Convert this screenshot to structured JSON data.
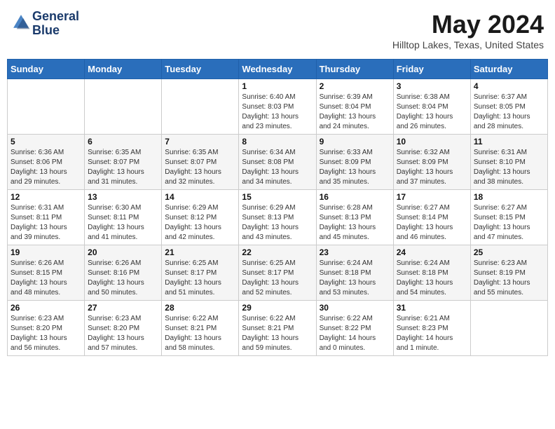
{
  "header": {
    "logo_line1": "General",
    "logo_line2": "Blue",
    "month_title": "May 2024",
    "location": "Hilltop Lakes, Texas, United States"
  },
  "weekdays": [
    "Sunday",
    "Monday",
    "Tuesday",
    "Wednesday",
    "Thursday",
    "Friday",
    "Saturday"
  ],
  "weeks": [
    [
      {
        "day": "",
        "info": ""
      },
      {
        "day": "",
        "info": ""
      },
      {
        "day": "",
        "info": ""
      },
      {
        "day": "1",
        "info": "Sunrise: 6:40 AM\nSunset: 8:03 PM\nDaylight: 13 hours\nand 23 minutes."
      },
      {
        "day": "2",
        "info": "Sunrise: 6:39 AM\nSunset: 8:04 PM\nDaylight: 13 hours\nand 24 minutes."
      },
      {
        "day": "3",
        "info": "Sunrise: 6:38 AM\nSunset: 8:04 PM\nDaylight: 13 hours\nand 26 minutes."
      },
      {
        "day": "4",
        "info": "Sunrise: 6:37 AM\nSunset: 8:05 PM\nDaylight: 13 hours\nand 28 minutes."
      }
    ],
    [
      {
        "day": "5",
        "info": "Sunrise: 6:36 AM\nSunset: 8:06 PM\nDaylight: 13 hours\nand 29 minutes."
      },
      {
        "day": "6",
        "info": "Sunrise: 6:35 AM\nSunset: 8:07 PM\nDaylight: 13 hours\nand 31 minutes."
      },
      {
        "day": "7",
        "info": "Sunrise: 6:35 AM\nSunset: 8:07 PM\nDaylight: 13 hours\nand 32 minutes."
      },
      {
        "day": "8",
        "info": "Sunrise: 6:34 AM\nSunset: 8:08 PM\nDaylight: 13 hours\nand 34 minutes."
      },
      {
        "day": "9",
        "info": "Sunrise: 6:33 AM\nSunset: 8:09 PM\nDaylight: 13 hours\nand 35 minutes."
      },
      {
        "day": "10",
        "info": "Sunrise: 6:32 AM\nSunset: 8:09 PM\nDaylight: 13 hours\nand 37 minutes."
      },
      {
        "day": "11",
        "info": "Sunrise: 6:31 AM\nSunset: 8:10 PM\nDaylight: 13 hours\nand 38 minutes."
      }
    ],
    [
      {
        "day": "12",
        "info": "Sunrise: 6:31 AM\nSunset: 8:11 PM\nDaylight: 13 hours\nand 39 minutes."
      },
      {
        "day": "13",
        "info": "Sunrise: 6:30 AM\nSunset: 8:11 PM\nDaylight: 13 hours\nand 41 minutes."
      },
      {
        "day": "14",
        "info": "Sunrise: 6:29 AM\nSunset: 8:12 PM\nDaylight: 13 hours\nand 42 minutes."
      },
      {
        "day": "15",
        "info": "Sunrise: 6:29 AM\nSunset: 8:13 PM\nDaylight: 13 hours\nand 43 minutes."
      },
      {
        "day": "16",
        "info": "Sunrise: 6:28 AM\nSunset: 8:13 PM\nDaylight: 13 hours\nand 45 minutes."
      },
      {
        "day": "17",
        "info": "Sunrise: 6:27 AM\nSunset: 8:14 PM\nDaylight: 13 hours\nand 46 minutes."
      },
      {
        "day": "18",
        "info": "Sunrise: 6:27 AM\nSunset: 8:15 PM\nDaylight: 13 hours\nand 47 minutes."
      }
    ],
    [
      {
        "day": "19",
        "info": "Sunrise: 6:26 AM\nSunset: 8:15 PM\nDaylight: 13 hours\nand 48 minutes."
      },
      {
        "day": "20",
        "info": "Sunrise: 6:26 AM\nSunset: 8:16 PM\nDaylight: 13 hours\nand 50 minutes."
      },
      {
        "day": "21",
        "info": "Sunrise: 6:25 AM\nSunset: 8:17 PM\nDaylight: 13 hours\nand 51 minutes."
      },
      {
        "day": "22",
        "info": "Sunrise: 6:25 AM\nSunset: 8:17 PM\nDaylight: 13 hours\nand 52 minutes."
      },
      {
        "day": "23",
        "info": "Sunrise: 6:24 AM\nSunset: 8:18 PM\nDaylight: 13 hours\nand 53 minutes."
      },
      {
        "day": "24",
        "info": "Sunrise: 6:24 AM\nSunset: 8:18 PM\nDaylight: 13 hours\nand 54 minutes."
      },
      {
        "day": "25",
        "info": "Sunrise: 6:23 AM\nSunset: 8:19 PM\nDaylight: 13 hours\nand 55 minutes."
      }
    ],
    [
      {
        "day": "26",
        "info": "Sunrise: 6:23 AM\nSunset: 8:20 PM\nDaylight: 13 hours\nand 56 minutes."
      },
      {
        "day": "27",
        "info": "Sunrise: 6:23 AM\nSunset: 8:20 PM\nDaylight: 13 hours\nand 57 minutes."
      },
      {
        "day": "28",
        "info": "Sunrise: 6:22 AM\nSunset: 8:21 PM\nDaylight: 13 hours\nand 58 minutes."
      },
      {
        "day": "29",
        "info": "Sunrise: 6:22 AM\nSunset: 8:21 PM\nDaylight: 13 hours\nand 59 minutes."
      },
      {
        "day": "30",
        "info": "Sunrise: 6:22 AM\nSunset: 8:22 PM\nDaylight: 14 hours\nand 0 minutes."
      },
      {
        "day": "31",
        "info": "Sunrise: 6:21 AM\nSunset: 8:23 PM\nDaylight: 14 hours\nand 1 minute."
      },
      {
        "day": "",
        "info": ""
      }
    ]
  ]
}
